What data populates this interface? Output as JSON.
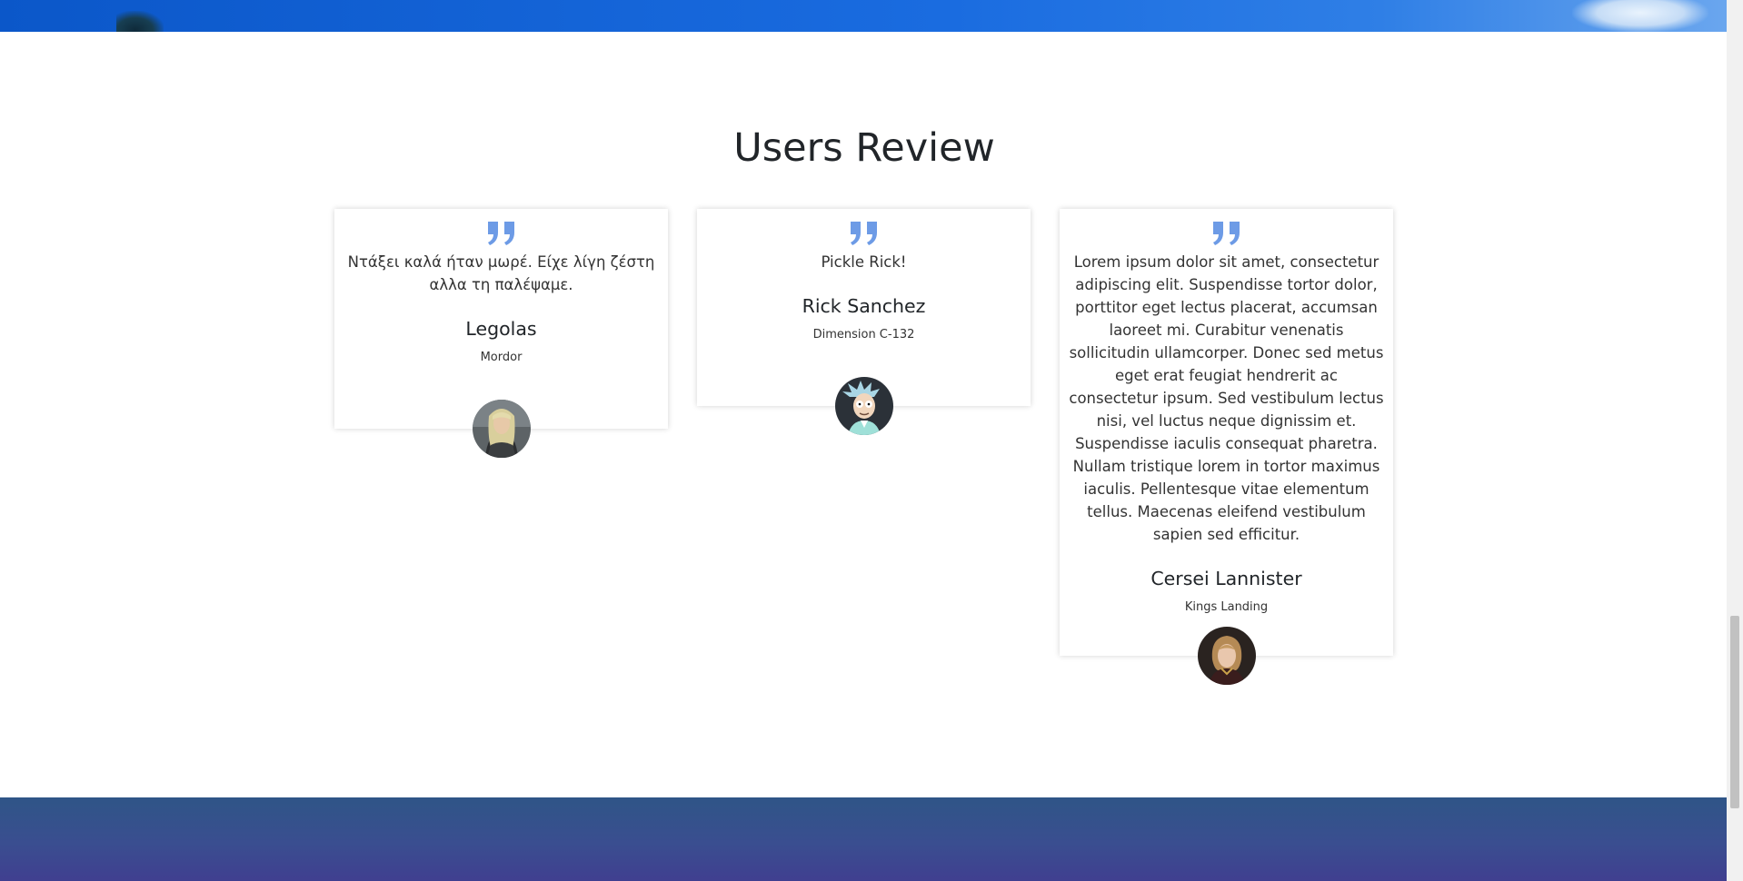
{
  "section": {
    "title": "Users Review"
  },
  "reviews": [
    {
      "text": "Ντάξει καλά ήταν μωρέ. Είχε λίγη ζέστη αλλα τη παλέψαμε.",
      "name": "Legolas",
      "location": "Mordor",
      "avatar_icon": "legolas-avatar"
    },
    {
      "text": "Pickle Rick!",
      "name": "Rick Sanchez",
      "location": "Dimension C-132",
      "avatar_icon": "rick-avatar"
    },
    {
      "text": "Lorem ipsum dolor sit amet, consectetur adipiscing elit. Suspendisse tortor dolor, porttitor eget lectus placerat, accumsan laoreet mi. Curabitur venenatis sollicitudin ullamcorper. Donec sed metus eget erat feugiat hendrerit ac consectetur ipsum. Sed vestibulum lectus nisi, vel luctus neque dignissim et. Suspendisse iaculis consequat pharetra. Nullam tristique lorem in tortor maximus iaculis. Pellentesque vitae elementum tellus. Maecenas eleifend vestibulum sapien sed efficitur.",
      "name": "Cersei Lannister",
      "location": "Kings Landing",
      "avatar_icon": "cersei-avatar"
    }
  ],
  "colors": {
    "quote_accent": "#6d9be6",
    "footer_top": "#2f5587",
    "footer_bottom": "#403f90",
    "hero_blue": "#0b57c9"
  }
}
